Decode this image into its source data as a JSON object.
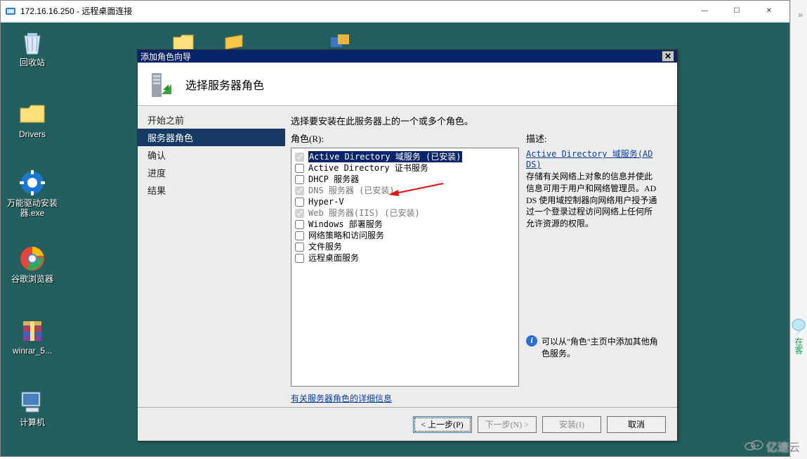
{
  "rdp": {
    "title": "172.16.16.250 - 远程桌面连接",
    "min_icon": "—",
    "max_icon": "☐",
    "close_icon": "✕"
  },
  "desktop_icons": {
    "recycle": "回收站",
    "drivers": "Drivers",
    "driver_tool": "万能驱动安装器.exe",
    "chrome": "谷歌浏览器",
    "winrar": "winrar_5...",
    "computer": "计算机"
  },
  "wizard": {
    "title": "添加角色向导",
    "header_title": "选择服务器角色",
    "nav": {
      "begin": "开始之前",
      "server_roles": "服务器角色",
      "confirm": "确认",
      "progress": "进度",
      "result": "结果"
    },
    "instruction": "选择要安装在此服务器上的一个或多个角色。",
    "roles_label": "角色(R):",
    "desc_label": "描述:",
    "roles": {
      "adds": "Active Directory 域服务  (已安装)",
      "adcs": "Active Directory 证书服务",
      "dhcp": "DHCP 服务器",
      "dns": "DNS 服务器  (已安装)",
      "hyperv": "Hyper-V",
      "iis": "Web 服务器(IIS)  (已安装)",
      "wds": "Windows 部署服务",
      "nps": "网络策略和访问服务",
      "file": "文件服务",
      "rds": "远程桌面服务"
    },
    "desc_link": "Active Directory 域服务(AD DS)",
    "desc_text": "存储有关网络上对象的信息并使此信息可用于用户和网络管理员。AD DS 使用域控制器向网络用户授予通过一个登录过程访问网络上任何所允许资源的权限。",
    "info_hint": "可以从\"角色\"主页中添加其他角色服务。",
    "more_link": "有关服务器角色的详细信息",
    "buttons": {
      "prev": "< 上一步(P)",
      "next": "下一步(N) >",
      "install": "安装(I)",
      "cancel": "取消"
    }
  },
  "watermark": "亿速云"
}
